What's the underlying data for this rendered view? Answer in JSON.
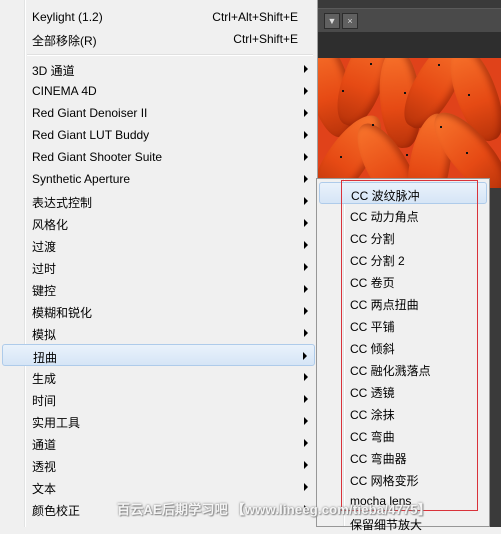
{
  "main_menu": {
    "top_items": [
      {
        "label": "Keylight (1.2)",
        "shortcut": "Ctrl+Alt+Shift+E"
      },
      {
        "label": "全部移除(R)",
        "shortcut": "Ctrl+Shift+E"
      }
    ],
    "items": [
      {
        "label": "3D 通道"
      },
      {
        "label": "CINEMA 4D"
      },
      {
        "label": "Red Giant Denoiser II"
      },
      {
        "label": "Red Giant LUT Buddy"
      },
      {
        "label": "Red Giant Shooter Suite"
      },
      {
        "label": "Synthetic Aperture"
      },
      {
        "label": "表达式控制"
      },
      {
        "label": "风格化"
      },
      {
        "label": "过渡"
      },
      {
        "label": "过时"
      },
      {
        "label": "键控"
      },
      {
        "label": "模糊和锐化"
      },
      {
        "label": "模拟"
      },
      {
        "label": "扭曲",
        "highlighted": true
      },
      {
        "label": "生成"
      },
      {
        "label": "时间"
      },
      {
        "label": "实用工具"
      },
      {
        "label": "通道"
      },
      {
        "label": "透视"
      },
      {
        "label": "文本"
      },
      {
        "label": "颜色校正"
      }
    ]
  },
  "submenu": {
    "items": [
      {
        "label": "CC 波纹脉冲",
        "highlighted": true
      },
      {
        "label": "CC 动力角点"
      },
      {
        "label": "CC 分割"
      },
      {
        "label": "CC 分割 2"
      },
      {
        "label": "CC 卷页"
      },
      {
        "label": "CC 两点扭曲"
      },
      {
        "label": "CC 平铺"
      },
      {
        "label": "CC 倾斜"
      },
      {
        "label": "CC 融化溅落点"
      },
      {
        "label": "CC 透镜"
      },
      {
        "label": "CC 涂抹"
      },
      {
        "label": "CC 弯曲"
      },
      {
        "label": "CC 弯曲器"
      },
      {
        "label": "CC 网格变形"
      },
      {
        "label": "mocha lens"
      },
      {
        "label": "保留细节放大"
      }
    ]
  },
  "background_panel": {
    "tab_menu_glyph": "▼",
    "tab_close_glyph": "×"
  },
  "watermark": "百云AE后期学习吧 【www.lineeg.com/tieba/4775】",
  "colors": {
    "highlight_border": "#aecbea",
    "annotation_red": "#d9323a",
    "image_orange": "#e64a14"
  }
}
